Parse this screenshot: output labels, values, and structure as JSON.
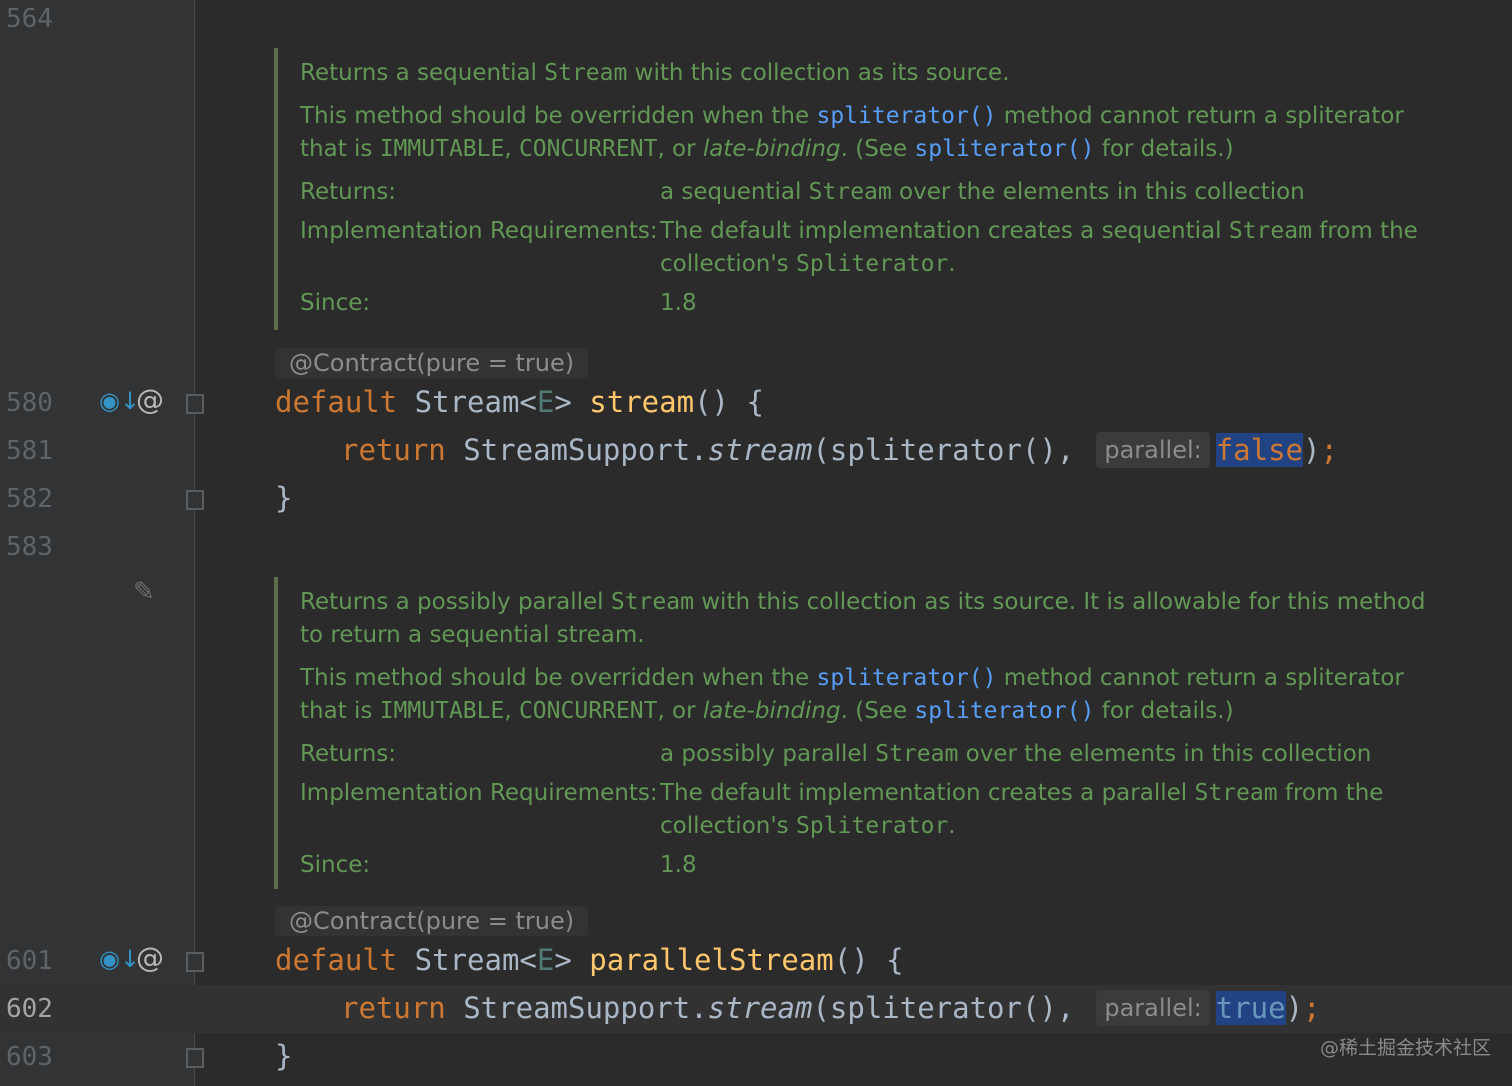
{
  "line_numbers": {
    "l564": "564",
    "l580": "580",
    "l581": "581",
    "l582": "582",
    "l583": "583",
    "l601": "601",
    "l602": "602",
    "l603": "603"
  },
  "gutter_icons": {
    "implemented": "◉↓",
    "annotation": "@",
    "edit": "✎"
  },
  "doc1": {
    "summary_pre": "Returns a sequential ",
    "summary_code": "Stream",
    "summary_post": " with this collection as its source.",
    "override_pre": "This method should be overridden when the ",
    "link1": "spliterator()",
    "override_mid": " method cannot return a spliterator that is ",
    "const1": "IMMUTABLE",
    "sep1": ", ",
    "const2": "CONCURRENT",
    "sep2": ", or ",
    "late": "late-binding",
    "see_pre": ". (See ",
    "link2": "spliterator()",
    "see_post": " for details.)",
    "returns_label": "Returns:",
    "returns_pre": "a sequential ",
    "returns_code": "Stream",
    "returns_post": " over the elements in this collection",
    "impl_label": "Implementation Requirements:",
    "impl_pre": "The default implementation creates a sequential ",
    "impl_code1": "Stream",
    "impl_mid": " from the collection's ",
    "impl_code2": "Spliterator",
    "impl_post": ".",
    "since_label": "Since:",
    "since_value": "1.8"
  },
  "doc2": {
    "summary_pre": "Returns a possibly parallel ",
    "summary_code": "Stream",
    "summary_post": " with this collection as its source. It is allowable for this method to return a sequential stream.",
    "override_pre": "This method should be overridden when the ",
    "link1": "spliterator()",
    "override_mid": " method cannot return a spliterator that is ",
    "const1": "IMMUTABLE",
    "sep1": ", ",
    "const2": "CONCURRENT",
    "sep2": ", or ",
    "late": "late-binding",
    "see_pre": ". (See ",
    "link2": "spliterator()",
    "see_post": " for details.)",
    "returns_label": "Returns:",
    "returns_pre": "a possibly parallel ",
    "returns_code": "Stream",
    "returns_post": " over the elements in this collection",
    "impl_label": "Implementation Requirements:",
    "impl_pre": "The default implementation creates a parallel ",
    "impl_code1": "Stream",
    "impl_mid": " from the collection's ",
    "impl_code2": "Spliterator",
    "impl_post": ".",
    "since_label": "Since:",
    "since_value": "1.8"
  },
  "method1": {
    "annotation": "@Contract(pure = true)",
    "sig_kw": "default",
    "sig_type": " Stream<",
    "sig_generic": "E",
    "sig_type_close": "> ",
    "sig_name": "stream",
    "sig_tail": "() {",
    "ret_kw": "return",
    "ret_call": " StreamSupport.",
    "ret_method": "stream",
    "ret_args": "(spliterator(),",
    "hint": "parallel:",
    "ret_value": "false",
    "ret_end_paren": ")",
    "ret_semicolon": ";",
    "close": "}"
  },
  "method2": {
    "annotation": "@Contract(pure = true)",
    "sig_kw": "default",
    "sig_type": " Stream<",
    "sig_generic": "E",
    "sig_type_close": "> ",
    "sig_name": "parallelStream",
    "sig_tail": "() {",
    "ret_kw": "return",
    "ret_call": " StreamSupport.",
    "ret_method": "stream",
    "ret_args": "(spliterator(),",
    "hint": "parallel:",
    "ret_value": "true",
    "ret_end_paren": ")",
    "ret_semicolon": ";",
    "close": "}"
  },
  "watermark": "@稀土掘金技术社区",
  "colors": {
    "background": "#2b2b2b",
    "gutter": "#313335",
    "keyword": "#cc7832",
    "method_decl": "#ffc66d",
    "doc_text": "#629755",
    "doc_link": "#589df6",
    "selection": "#214283"
  }
}
